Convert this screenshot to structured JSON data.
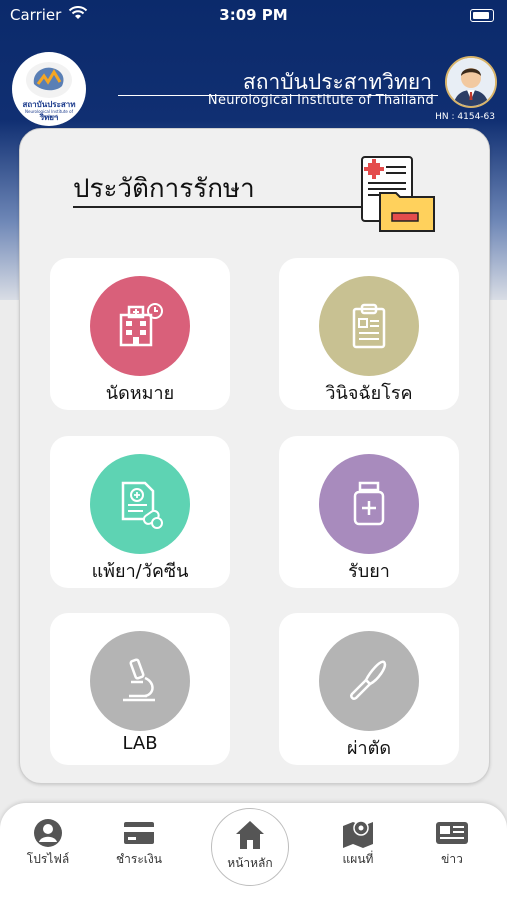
{
  "status_bar": {
    "carrier": "Carrier",
    "time": "3:09 PM"
  },
  "header": {
    "logo_text": "สถาบันประสาทวิทยา",
    "institute_th": "สถาบันประสาทวิทยา",
    "institute_en": "Neurological Institute of Thailand",
    "hn": "HN : 4154-63"
  },
  "section": {
    "title": "ประวัติการรักษา"
  },
  "menu": [
    {
      "label": "นัดหมาย",
      "color": "#d9607a",
      "icon": "hospital-icon"
    },
    {
      "label": "วินิจฉัยโรค",
      "color": "#c8c192",
      "icon": "clipboard-icon"
    },
    {
      "label": "แพ้ยา/วัคซีน",
      "color": "#5ed3b3",
      "icon": "allergy-document-icon"
    },
    {
      "label": "รับยา",
      "color": "#a88bbd",
      "icon": "medicine-bottle-icon"
    },
    {
      "label": "LAB",
      "color": "#b4b4b4",
      "icon": "microscope-icon"
    },
    {
      "label": "ผ่าตัด",
      "color": "#b4b4b4",
      "icon": "scalpel-icon"
    }
  ],
  "nav": {
    "profile": "โปรไฟล์",
    "payment": "ชำระเงิน",
    "home": "หน้าหลัก",
    "map": "แผนที่",
    "news": "ข่าว"
  }
}
